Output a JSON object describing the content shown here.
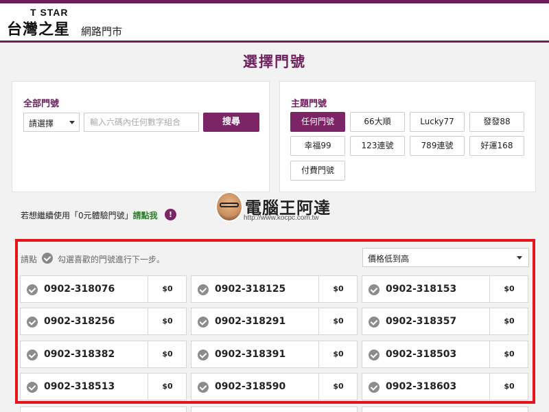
{
  "brand": {
    "small": "T STAR",
    "name": "台灣之星",
    "section": "網路門市"
  },
  "page_title": "選擇門號",
  "all_numbers": {
    "title": "全部門號",
    "select_value": "請選擇",
    "search_placeholder": "輸入六碼內任何數字組合",
    "search_button": "搜尋"
  },
  "theme_numbers": {
    "title": "主題門號",
    "buttons": [
      "任何門號",
      "66大順",
      "Lucky77",
      "發發88",
      "幸福99",
      "123連號",
      "789連號",
      "好運168",
      "付費門號"
    ]
  },
  "trial": {
    "text": "若想繼續使用「0元體驗門號」",
    "link": "請點我",
    "icon": "!"
  },
  "watermark": {
    "title": "電腦王阿達",
    "url": "http://www.kocpc.com.tw"
  },
  "results": {
    "hint_prefix": "請點",
    "hint_suffix": "勾選喜歡的門號進行下一步。",
    "sort_value": "價格低到高",
    "numbers": [
      {
        "number": "0902-318076",
        "price": "$0"
      },
      {
        "number": "0902-318125",
        "price": "$0"
      },
      {
        "number": "0902-318153",
        "price": "$0"
      },
      {
        "number": "0902-318256",
        "price": "$0"
      },
      {
        "number": "0902-318291",
        "price": "$0"
      },
      {
        "number": "0902-318357",
        "price": "$0"
      },
      {
        "number": "0902-318382",
        "price": "$0"
      },
      {
        "number": "0902-318391",
        "price": "$0"
      },
      {
        "number": "0902-318503",
        "price": "$0"
      },
      {
        "number": "0902-318513",
        "price": "$0"
      },
      {
        "number": "0902-318590",
        "price": "$0"
      },
      {
        "number": "0902-318603",
        "price": "$0"
      }
    ]
  },
  "colors": {
    "brand": "#6e1f5e",
    "button": "#7b2466",
    "highlight_frame": "#e8141d",
    "link_green": "#2d7d2d"
  }
}
